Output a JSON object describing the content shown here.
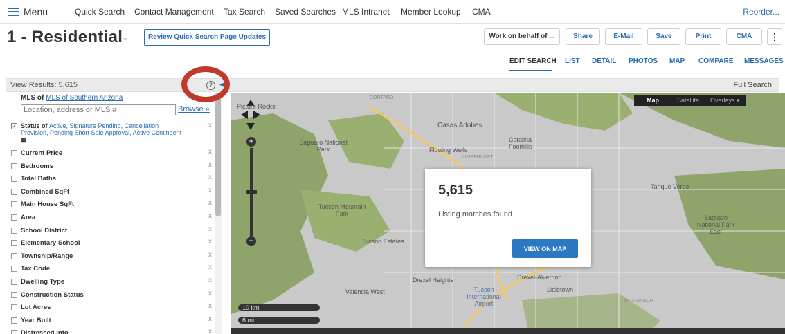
{
  "topnav": {
    "menu_label": "Menu",
    "links": [
      "Quick Search",
      "Contact Management",
      "Tax Search",
      "Saved Searches",
      "MLS Intranet",
      "Member Lookup",
      "CMA"
    ],
    "reorder": "Reorder..."
  },
  "header": {
    "title": "1 - Residential",
    "review_button": "Review Quick Search Page Updates",
    "work_on_behalf": "Work on behalf of ...",
    "share": "Share",
    "email": "E-Mail",
    "save": "Save",
    "print": "Print",
    "cma": "CMA",
    "more": "⋮"
  },
  "tabs": [
    "EDIT SEARCH",
    "LIST",
    "DETAIL",
    "PHOTOS",
    "MAP",
    "COMPARE",
    "MESSAGES"
  ],
  "results_bar": {
    "view_results": "View Results: 5,615",
    "full_search": "Full Search"
  },
  "left_panel": {
    "mls_prefix": "MLS of ",
    "mls_name": "MLS of Southern Arizona",
    "location_placeholder": "Location, address or MLS #",
    "browse": "Browse »",
    "status_prefix": "Status of ",
    "status_values": "Active, Signature Pending, Cancellation Provision, Pending Short Sale Approval, Active Contingent",
    "filters": [
      "Current Price",
      "Bedrooms",
      "Total Baths",
      "Combined SqFt",
      "Main House SqFt",
      "Area",
      "School District",
      "Elementary School",
      "Township/Range",
      "Tax Code",
      "Dwelling Type",
      "Construction Status",
      "Lot Acres",
      "Year Built",
      "Distressed Info"
    ]
  },
  "map": {
    "type_buttons": [
      "Map",
      "Satellite",
      "Overlays ▾"
    ],
    "labels": {
      "catalina_foothills": "Catalina Foothills",
      "casas_adobes": "Casas Adobes",
      "saguaro_np": "Saguaro National Park",
      "flowing_wells": "Flowing Wells",
      "tucson_mountain_park": "Tucson Mountain Park",
      "tanque_verde": "Tanque Verde",
      "saguaro_east": "Saguaro National Park East",
      "tucson_estates": "Tucson Estates",
      "drexel_heights": "Drexel Heights",
      "drexel_alvernon": "Drexel-Alvernon",
      "valencia_west": "Valencia West",
      "tucson_airport": "Tucson International Airport",
      "littletown": "Littletown",
      "rita_ranch": "RITA RANCH",
      "picture_rocks": "Picture Rocks",
      "cortaro": "CORTARO",
      "limberlost": "LIMBERLOST"
    },
    "scale_km": "10 km",
    "scale_mi": "6 mi"
  },
  "popup": {
    "count": "5,615",
    "message": "Listing matches found",
    "button": "VIEW ON MAP"
  },
  "colors": {
    "accent": "#2a6db0",
    "annotation_circle": "#c0392b",
    "park_green": "#8fa46a",
    "map_gray": "#c9c9c9"
  }
}
